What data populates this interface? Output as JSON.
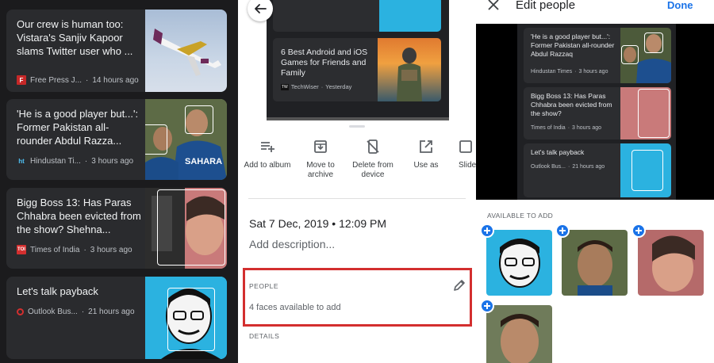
{
  "left_feed": {
    "cards": [
      {
        "title": "Our crew is human too: Vistara's Sanjiv Kapoor slams Twitter user who ...",
        "source": "Free Press J...",
        "time": "14 hours ago",
        "logo": "F",
        "logo_color": "#c62828"
      },
      {
        "title": "'He is a good player but...': Former Pakistan all-rounder Abdul Razza...",
        "source": "Hindustan Ti...",
        "time": "3 hours ago",
        "logo": "ht",
        "logo_color": "#4fc3f7"
      },
      {
        "title": "Bigg Boss 13: Has Paras Chhabra been evicted from the show? Shehna...",
        "source": "Times of India",
        "time": "3 hours ago",
        "logo": "TOI",
        "logo_color": "#d32f2f"
      },
      {
        "title": "Let's talk payback",
        "source": "Outlook Bus...",
        "time": "21 hours ago",
        "logo": "",
        "logo_color": "#d32f2f"
      }
    ]
  },
  "details": {
    "preview_card": {
      "title": "6 Best Android and iOS Games for Friends and Family",
      "source": "TechWiser",
      "time": "Yesterday",
      "logo": "TW"
    },
    "actions": [
      {
        "label": "Add to album",
        "icon": "add-to-album-icon"
      },
      {
        "label": "Move to archive",
        "icon": "archive-icon"
      },
      {
        "label": "Delete from device",
        "icon": "delete-from-device-icon"
      },
      {
        "label": "Use as",
        "icon": "open-external-icon"
      },
      {
        "label": "Slide",
        "icon": "slideshow-icon"
      }
    ],
    "date": "Sat 7 Dec, 2019",
    "time": "12:09 PM",
    "description_placeholder": "Add description...",
    "people_label": "PEOPLE",
    "people_text": "4 faces available to add",
    "details_label": "DETAILS",
    "highlight_color": "#d32f2f"
  },
  "edit_people": {
    "title": "Edit people",
    "done_label": "Done",
    "accent": "#1a73e8",
    "preview_cards": [
      {
        "title": "'He is a good player but...': Former Pakistan all-rounder Abdul Razzaq",
        "source": "Hindustan Times",
        "time": "3 hours ago"
      },
      {
        "title": "Bigg Boss 13: Has Paras Chhabra been evicted from the show?",
        "source": "Times of India",
        "time": "3 hours ago"
      },
      {
        "title": "Let's talk payback",
        "source": "Outlook Bus...",
        "time": "21 hours ago"
      }
    ],
    "available_label": "AVAILABLE TO ADD",
    "faces_count": 4
  }
}
